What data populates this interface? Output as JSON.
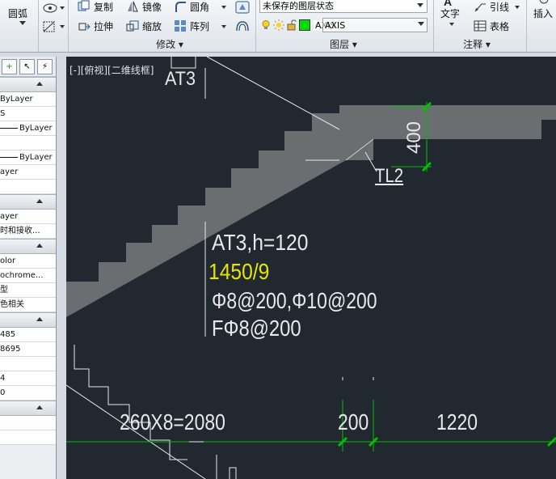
{
  "ribbon": {
    "arc_label": "圆弧",
    "modify": {
      "copy": "复制",
      "mirror": "镜像",
      "fillet": "圆角",
      "stretch": "拉伸",
      "scale": "缩放",
      "array": "阵列",
      "group_label": "修改"
    },
    "layers": {
      "state_value": "未保存的图层状态",
      "layer_value": "AXIS",
      "layer_color": "#00dd00",
      "group_label": "图层"
    },
    "annotation": {
      "text": "文字",
      "leader": "引线",
      "table": "表格",
      "group_label": "注释"
    },
    "insert": "插入"
  },
  "palette": {
    "rows_a": [
      "ByLayer",
      "S",
      "ByLayer",
      "",
      "ByLayer",
      "ayer"
    ],
    "rows_b": [
      "ayer",
      "时和接收..."
    ],
    "rows_c": [
      "olor",
      "ochrome...",
      "型",
      "色相关"
    ],
    "rows_d": [
      "485",
      "8695",
      "",
      "4",
      "0"
    ]
  },
  "canvas": {
    "viewport_label": "[-][俯视][二维线框]",
    "texts": {
      "at3_top": "AT3",
      "tl2": "TL2",
      "dim_400": "400",
      "at3_h": "AT3,h=120",
      "ratio": "1450/9",
      "rebar1": "Φ8@200,Φ10@200",
      "rebar2": "FΦ8@200",
      "dim_2080": "260X8=2080",
      "dim_200": "200",
      "dim_1220": "1220"
    },
    "colors": {
      "background": "#212830",
      "stair_fill": "#6b6e70",
      "line": "#e8e8e8",
      "dimension": "#00c000",
      "highlight_text": "#e6e600"
    }
  }
}
